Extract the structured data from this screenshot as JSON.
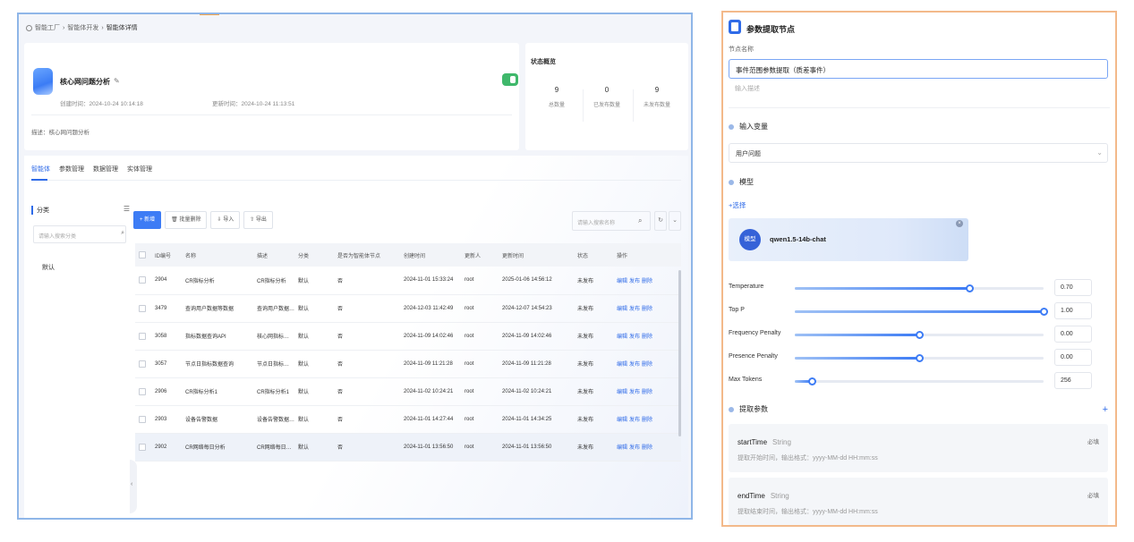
{
  "left": {
    "breadcrumb": [
      "智能工厂",
      "智能体开发",
      "智能体详情"
    ],
    "app": {
      "name": "核心网问题分析",
      "created": "创建时间：2024-10-24 10:14:18",
      "updated": "更新时间：2024-10-24 11:13:51",
      "description": "描述：核心网问题分析"
    },
    "stats": {
      "title": "状态概览",
      "items": [
        {
          "value": "9",
          "label": "总数量"
        },
        {
          "value": "0",
          "label": "已发布数量"
        },
        {
          "value": "9",
          "label": "未发布数量"
        }
      ]
    },
    "tabs": [
      "智能体",
      "参数管理",
      "数据管理",
      "实体管理"
    ],
    "category": {
      "title": "分类",
      "search_placeholder": "请输入搜索分类",
      "items": [
        "默认"
      ]
    },
    "toolbar": {
      "new": "+ 新增",
      "batch_delete": "批量删除",
      "import": "导入",
      "export": "导出",
      "search_placeholder": "请输入搜索名称"
    },
    "table": {
      "headers": [
        "ID编号",
        "名称",
        "描述",
        "分类",
        "是否为智能体节点",
        "创建时间",
        "更新人",
        "更新时间",
        "状态",
        "操作"
      ],
      "rows": [
        {
          "id": "2904",
          "name": "CR指标分析",
          "desc": "CR指标分析",
          "cat": "默认",
          "flag": "否",
          "created": "2024-11-01 15:33:24",
          "user": "root",
          "updated": "2025-01-06 14:56:12",
          "status": "未发布"
        },
        {
          "id": "3479",
          "name": "查询用户数据等数据",
          "desc": "查询用户数据…",
          "cat": "默认",
          "flag": "否",
          "created": "2024-12-03 11:42:49",
          "user": "root",
          "updated": "2024-12-07 14:54:23",
          "status": "未发布"
        },
        {
          "id": "3058",
          "name": "指标数据查询API",
          "desc": "核心网指标…",
          "cat": "默认",
          "flag": "否",
          "created": "2024-11-09 14:02:46",
          "user": "root",
          "updated": "2024-11-09 14:02:46",
          "status": "未发布"
        },
        {
          "id": "3057",
          "name": "节点日指标数据查询",
          "desc": "节点日指标…",
          "cat": "默认",
          "flag": "否",
          "created": "2024-11-09 11:21:28",
          "user": "root",
          "updated": "2024-11-09 11:21:28",
          "status": "未发布"
        },
        {
          "id": "2906",
          "name": "CR指标分析1",
          "desc": "CR指标分析1",
          "cat": "默认",
          "flag": "否",
          "created": "2024-11-02 10:24:21",
          "user": "root",
          "updated": "2024-11-02 10:24:21",
          "status": "未发布"
        },
        {
          "id": "2903",
          "name": "设备告警数据",
          "desc": "设备告警数据…",
          "cat": "默认",
          "flag": "否",
          "created": "2024-11-01 14:27:44",
          "user": "root",
          "updated": "2024-11-01 14:34:25",
          "status": "未发布"
        },
        {
          "id": "2902",
          "name": "CR网络每日分析",
          "desc": "CR网络每日…",
          "cat": "默认",
          "flag": "否",
          "created": "2024-11-01 13:56:50",
          "user": "root",
          "updated": "2024-11-01 13:56:50",
          "status": "未发布"
        }
      ],
      "ops": [
        "编辑",
        "发布",
        "删除"
      ]
    }
  },
  "right": {
    "title": "参数提取节点",
    "name_label": "节点名称",
    "name_value": "事件范围参数提取（质差事件）",
    "desc_placeholder": "输入描述",
    "input_var_title": "输入变量",
    "input_var_value": "用户问题",
    "model_title": "模型",
    "model_add": "+选择",
    "model": {
      "badge": "模型",
      "name": "qwen1.5-14b-chat"
    },
    "params": [
      {
        "label": "Temperature",
        "value": "0.70",
        "fraction": 0.7
      },
      {
        "label": "Top P",
        "value": "1.00",
        "fraction": 1.0
      },
      {
        "label": "Frequency Penalty",
        "value": "0.00",
        "fraction": 0.5
      },
      {
        "label": "Presence Penalty",
        "value": "0.00",
        "fraction": 0.5
      },
      {
        "label": "Max Tokens",
        "value": "256",
        "fraction": 0.07
      }
    ],
    "extract_title": "提取参数",
    "fields": [
      {
        "name": "startTime",
        "type": "String",
        "desc": "提取开始时间，输出格式：yyyy-MM-dd HH:mm:ss",
        "required": "必填"
      },
      {
        "name": "endTime",
        "type": "String",
        "desc": "提取结束时间，输出格式：yyyy-MM-dd HH:mm:ss",
        "required": "必填"
      }
    ]
  },
  "colors": {
    "accent": "#2f6be8",
    "left_border": "#8fb6e8",
    "right_border": "#f3b98a",
    "toggle_on": "#3fb86b"
  },
  "icons": [
    "home-icon",
    "edit-icon",
    "menu-icon",
    "search-icon",
    "refresh-icon",
    "filter-icon",
    "close-icon",
    "chevron-down-icon",
    "plus-icon"
  ]
}
